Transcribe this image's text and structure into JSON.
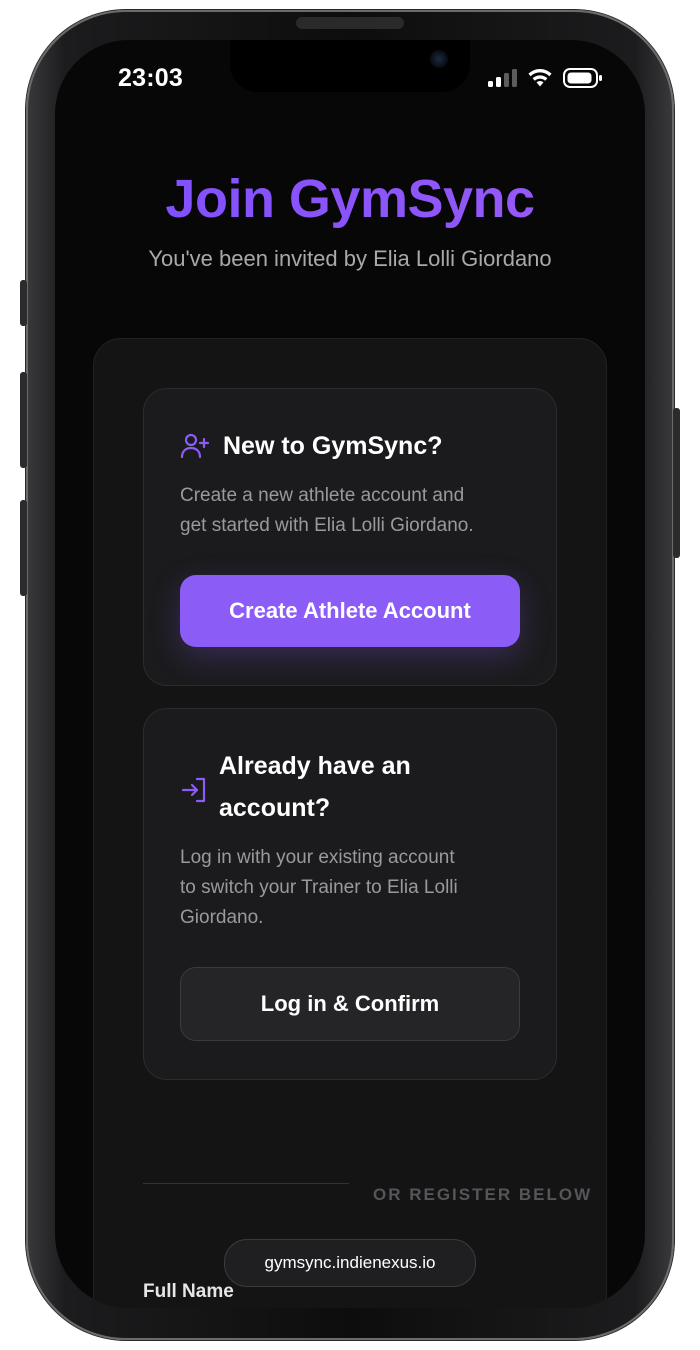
{
  "status_bar": {
    "time": "23:03",
    "signal_icon": "cellular-signal-icon",
    "wifi_icon": "wifi-icon",
    "battery_icon": "battery-icon"
  },
  "header": {
    "title": "Join GymSync",
    "subtitle": "You've been invited by Elia Lolli Giordano"
  },
  "new_account_card": {
    "icon": "user-plus-icon",
    "heading": "New to GymSync?",
    "description_line1": "Create a new athlete account and",
    "description_line2": "get started with Elia Lolli Giordano.",
    "button_label": "Create Athlete Account"
  },
  "existing_account_card": {
    "icon": "login-arrow-icon",
    "heading_line1": "Already have an",
    "heading_line2": "account?",
    "description_line1": "Log in with your existing account",
    "description_line2": "to switch your Trainer to Elia Lolli",
    "description_line3": "Giordano.",
    "button_label": "Log in & Confirm"
  },
  "divider": {
    "label": "OR REGISTER BELOW"
  },
  "register_form": {
    "full_name_label": "Full Name"
  },
  "browser": {
    "url": "gymsync.indienexus.io"
  },
  "colors": {
    "accent": "#8b5cf6",
    "background": "#070707",
    "card": "#1b1b1d"
  }
}
